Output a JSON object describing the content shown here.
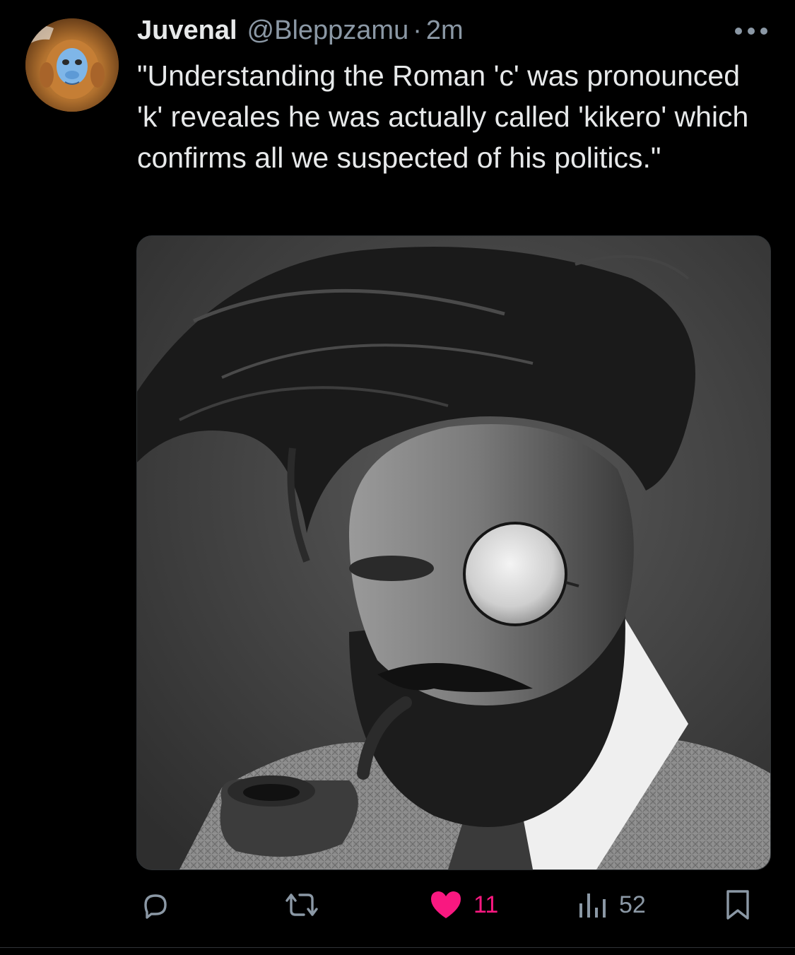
{
  "tweet": {
    "display_name": "Juvenal",
    "handle": "@Bleppzamu",
    "separator": "·",
    "time": "2m",
    "text": "\"Understanding the Roman 'c' was pronounced 'k' reveales he was actually called 'kikero' which confirms all we suspected of his politics.\"",
    "avatar_icon": "golden-snub-nosed-monkey-avatar",
    "media_description_icon": "bearded-man-monocle-pipe-photo"
  },
  "actions": {
    "reply": {
      "icon": "reply-icon",
      "count": ""
    },
    "retweet": {
      "icon": "retweet-icon",
      "count": ""
    },
    "like": {
      "icon": "heart-filled-icon",
      "count": "11",
      "color": "#f91880"
    },
    "views": {
      "icon": "views-bar-chart-icon",
      "count": "52"
    },
    "bookmark": {
      "icon": "bookmark-icon",
      "count": ""
    }
  },
  "colors": {
    "background": "#000000",
    "primary_text": "#e7e9ea",
    "secondary_text": "#8b98a5",
    "like_accent": "#f91880",
    "divider": "#2f3336"
  }
}
